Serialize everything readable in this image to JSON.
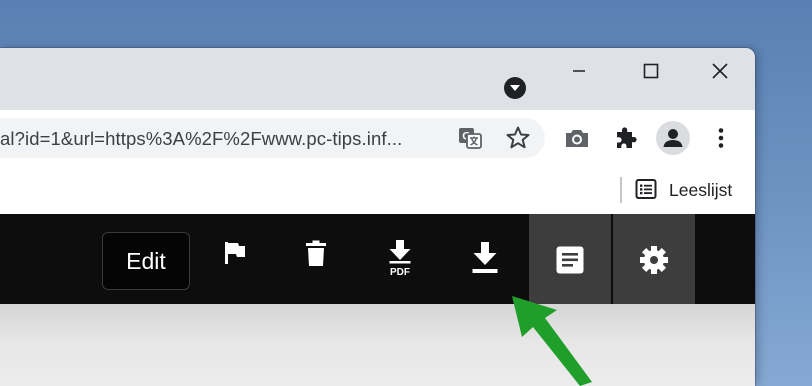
{
  "window": {
    "controls": [
      "minimize-icon",
      "maximize-icon",
      "close-icon"
    ],
    "profile_dropdown_icon": "chevron-down-icon"
  },
  "address_bar": {
    "url": "al?id=1&url=https%3A%2F%2Fwww.pc-tips.inf..."
  },
  "toolbar_icons": [
    "translate-icon",
    "star-icon",
    "camera-icon",
    "extensions-icon",
    "account-icon",
    "more-menu-icon"
  ],
  "bookmarks_bar": {
    "reading_list_label": "Leeslijst"
  },
  "reader_toolbar": {
    "edit_label": "Edit",
    "pdf_label": "PDF",
    "buttons": [
      "flag-icon",
      "trash-icon",
      "pdf-download-icon",
      "download-icon",
      "reader-view-icon",
      "settings-icon"
    ]
  },
  "annotation": {
    "arrow_color": "#1f9e2a"
  },
  "colors": {
    "desktop": "#6f95c4",
    "chrome_frame": "#dee1e6",
    "reader_toolbar": "#0d0d0d",
    "active_panel": "#3d3d3d"
  }
}
